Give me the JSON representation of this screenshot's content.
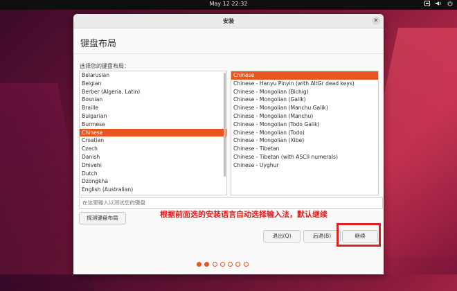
{
  "topbar": {
    "clock": "May 12  22:32",
    "network_icon": "network-icon",
    "volume_icon": "volume-icon",
    "power_icon": "power-icon"
  },
  "window": {
    "title": "安装"
  },
  "page": {
    "title": "键盘布局",
    "prompt": "选择您的键盘布局："
  },
  "layouts": [
    "Belarusian",
    "Belgian",
    "Berber (Algeria, Latin)",
    "Bosnian",
    "Braille",
    "Bulgarian",
    "Burmese",
    "Chinese",
    "Croatian",
    "Czech",
    "Danish",
    "Dhivehi",
    "Dutch",
    "Dzongkha",
    "English (Australian)"
  ],
  "layouts_selected": "Chinese",
  "variants": [
    "Chinese",
    "Chinese - Hanyu Pinyin (with AltGr dead keys)",
    "Chinese - Mongolian (Bichig)",
    "Chinese - Mongolian (Galik)",
    "Chinese - Mongolian (Manchu Galik)",
    "Chinese - Mongolian (Manchu)",
    "Chinese - Mongolian (Todo Galik)",
    "Chinese - Mongolian (Todo)",
    "Chinese - Mongolian (Xibe)",
    "Chinese - Tibetan",
    "Chinese - Tibetan (with ASCII numerals)",
    "Chinese - Uyghur"
  ],
  "variants_selected": "Chinese",
  "test_input": {
    "placeholder": "在这里输入以测试您的键盘",
    "value": ""
  },
  "buttons": {
    "detect": "探测键盘布局",
    "quit": "退出(Q)",
    "back": "后退(B)",
    "continue": "继续"
  },
  "progress": {
    "total": 7,
    "done": 2
  },
  "annotation": "根据前面选的安装语言自动选择输入法，默认继续",
  "colors": {
    "accent": "#e95420",
    "annotation": "#e01e1e"
  }
}
